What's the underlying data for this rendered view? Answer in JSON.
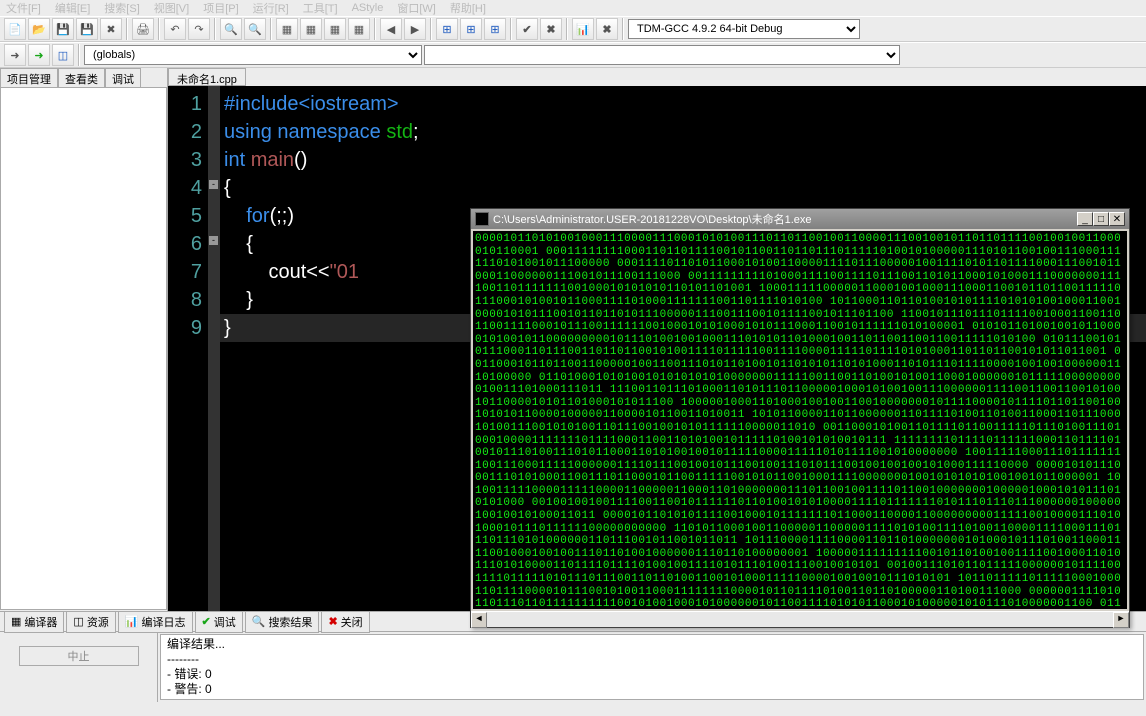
{
  "menu": {
    "items": [
      "文件[F]",
      "编辑[E]",
      "搜索[S]",
      "视图[V]",
      "项目[P]",
      "运行[R]",
      "工具[T]",
      "AStyle",
      "窗口[W]",
      "帮助[H]"
    ]
  },
  "toolbar2": {
    "compiler_label": "TDM-GCC 4.9.2 64-bit Debug",
    "globals": "(globals)"
  },
  "side_tabs": [
    "项目管理",
    "查看类",
    "调试"
  ],
  "file_tab": "未命名1.cpp",
  "code": {
    "lines": [
      {
        "n": "1",
        "html": "<span class='tk-pp'>#include</span><span class='tk-pp'>&lt;iostream&gt;</span>"
      },
      {
        "n": "2",
        "html": "<span class='tk-kw'>using</span> <span class='tk-kw'>namespace</span> <span class='tk-ns'>std</span>;"
      },
      {
        "n": "3",
        "html": "<span class='tk-kw'>int</span> <span class='tk-fn'>main</span>()"
      },
      {
        "n": "4",
        "html": "{"
      },
      {
        "n": "5",
        "html": "    <span class='tk-kw'>for</span>(;;)"
      },
      {
        "n": "6",
        "html": "    {"
      },
      {
        "n": "7",
        "html": "        cout&lt;&lt;<span class='tk-str'>\"01</span>"
      },
      {
        "n": "8",
        "html": "    }"
      },
      {
        "n": "9",
        "html": "}"
      }
    ]
  },
  "console": {
    "title": "C:\\Users\\Administrator.USER-20181228VO\\Desktop\\未命名1.exe",
    "pattern": "01"
  },
  "bottom_tabs": {
    "t1": "编译器",
    "t2": "资源",
    "t3": "编译日志",
    "t4": "调试",
    "t5": "搜索结果",
    "t6": "关闭"
  },
  "abort_label": "中止",
  "log": {
    "l1": "编译结果...",
    "l2": "--------",
    "l3": "- 错误: 0",
    "l4": "- 警告: 0"
  }
}
